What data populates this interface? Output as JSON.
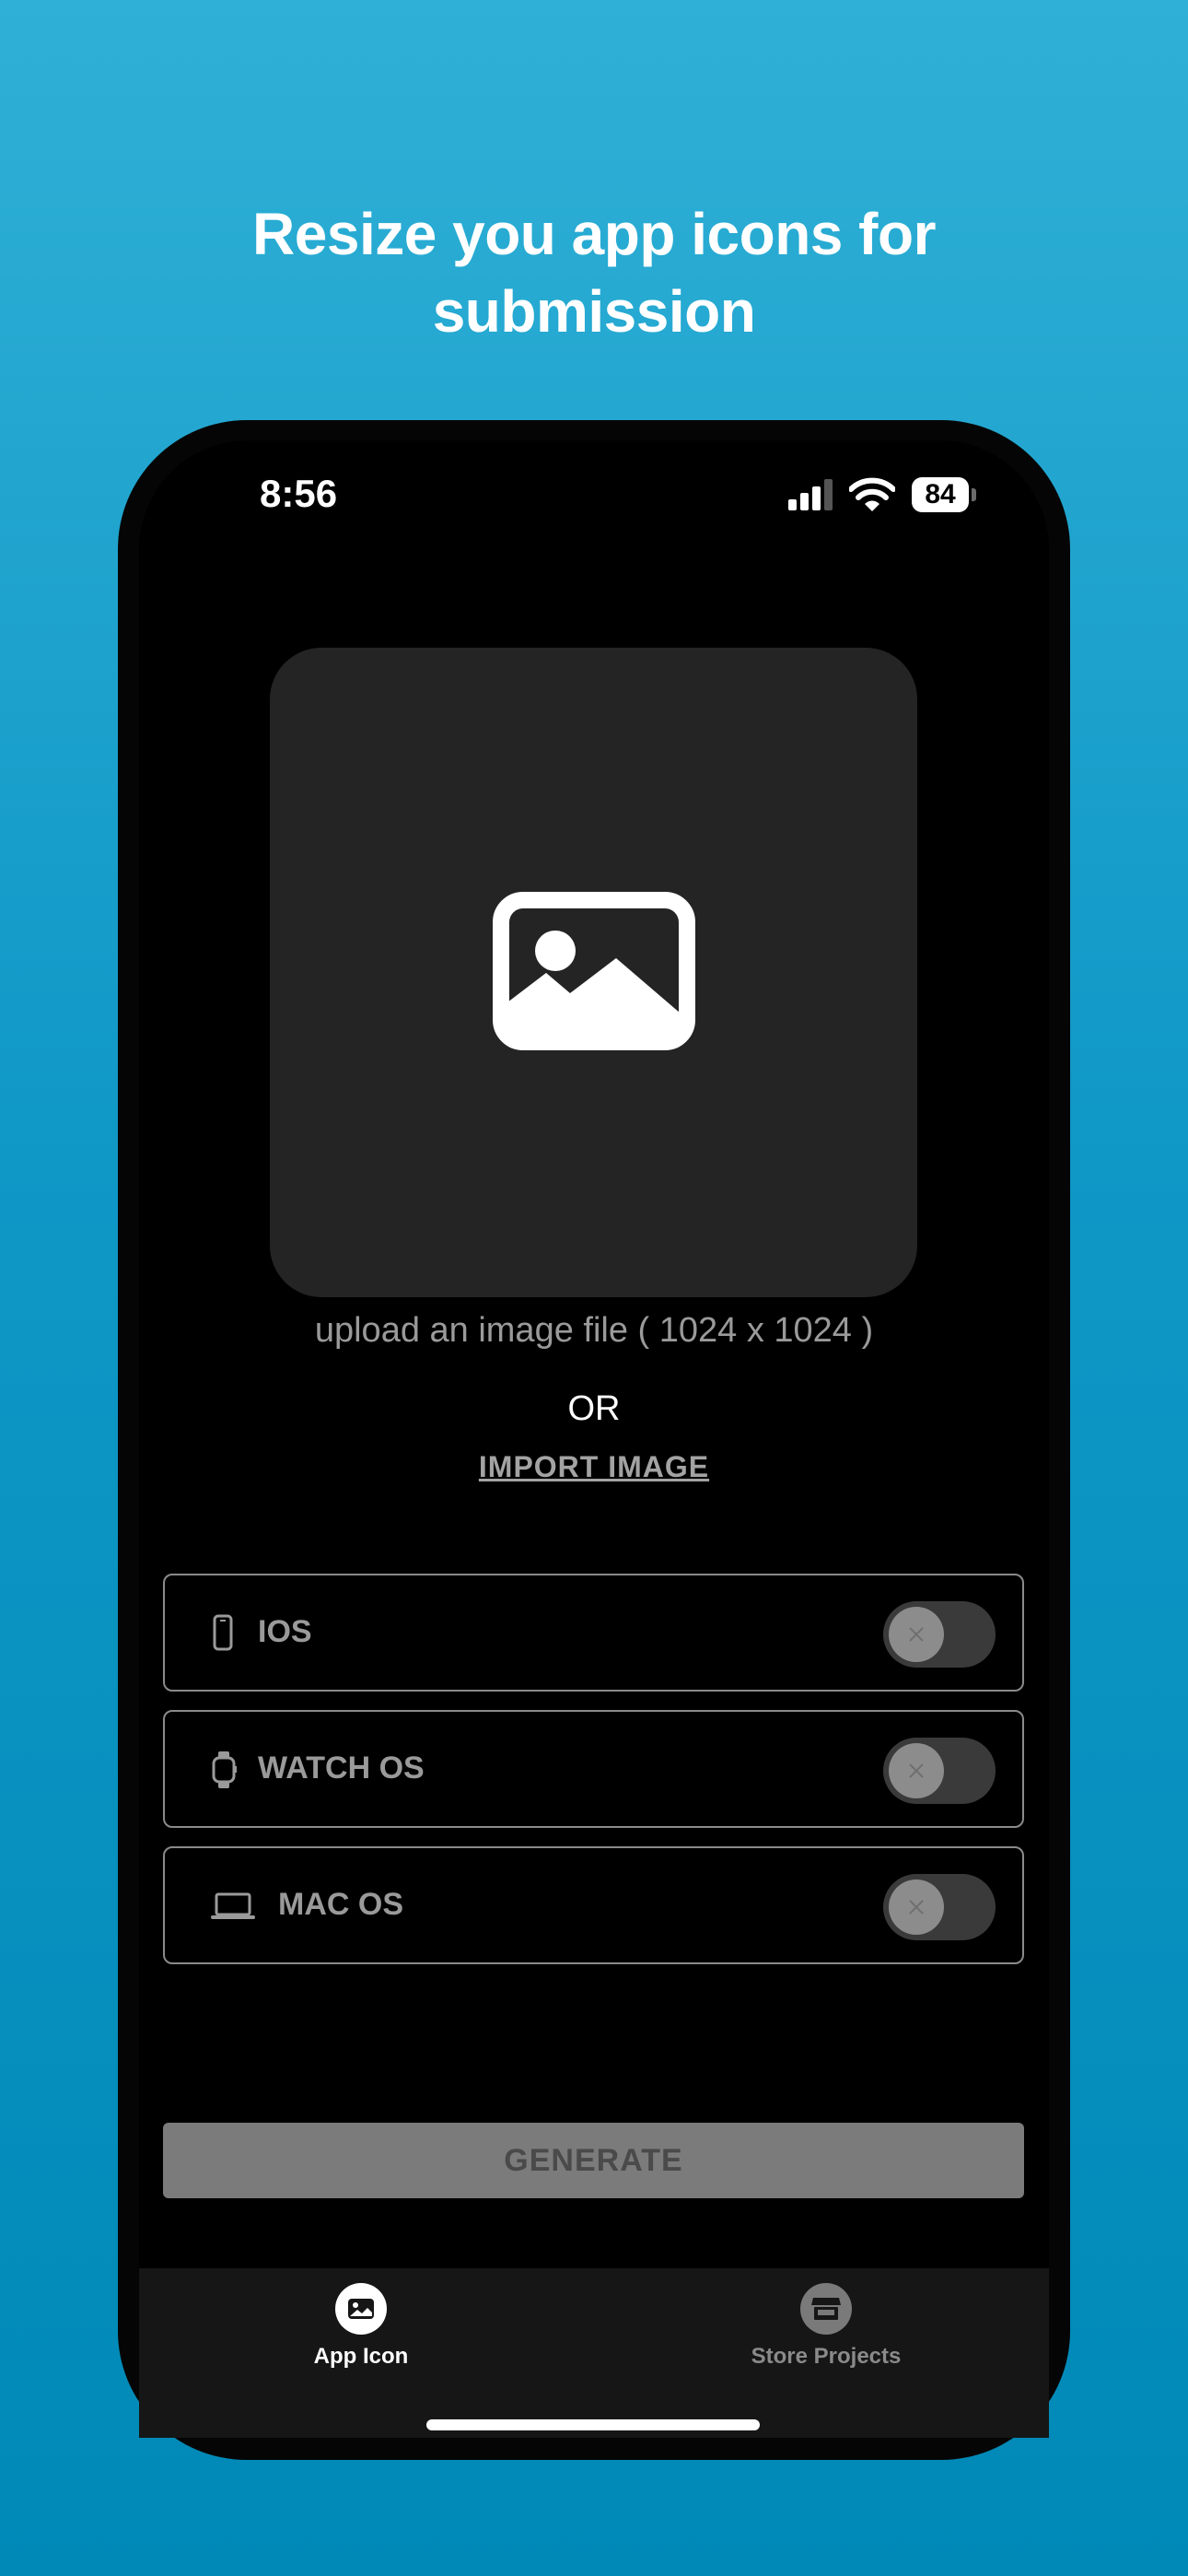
{
  "marketing": {
    "headline_line1": "Resize you app icons for",
    "headline_line2": "submission"
  },
  "status_bar": {
    "time": "8:56",
    "battery": "84",
    "icons": [
      "cellular-signal-icon",
      "wifi-icon",
      "battery-icon"
    ]
  },
  "upload": {
    "icon": "photo-icon",
    "hint": "upload an image file ( 1024 x 1024 )",
    "or_text": "OR",
    "import_label": "IMPORT IMAGE"
  },
  "options": [
    {
      "label": "IOS",
      "icon": "iphone-icon",
      "enabled": false
    },
    {
      "label": "WATCH OS",
      "icon": "watch-icon",
      "enabled": false
    },
    {
      "label": "MAC OS",
      "icon": "laptop-icon",
      "enabled": false
    }
  ],
  "generate": {
    "label": "GENERATE"
  },
  "tabbar": {
    "tabs": [
      {
        "label": "App Icon",
        "icon": "photo-icon",
        "selected": true
      },
      {
        "label": "Store Projects",
        "icon": "storefront-icon",
        "selected": false
      }
    ]
  },
  "colors": {
    "background_top": "#2fb0d6",
    "background_bottom": "#0089b7",
    "card": "#242424",
    "toggle_off": "#3a3a3a",
    "button_disabled": "#7b7b7b",
    "tabbar": "#161616"
  }
}
